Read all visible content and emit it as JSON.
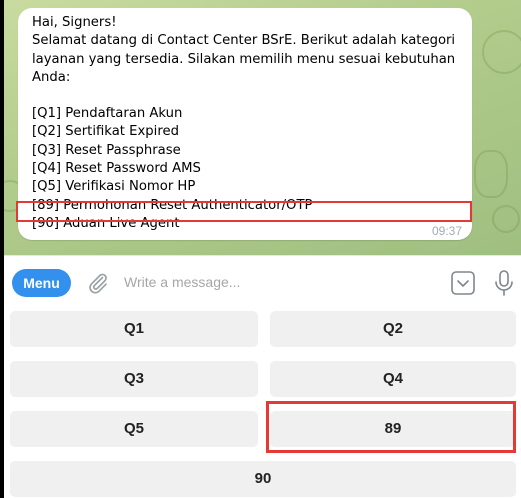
{
  "message": {
    "greeting": "Hai, Signers!",
    "intro": "Selamat datang di Contact Center BSrE. Berikut adalah kategori layanan yang tersedia. Silakan memilih menu sesuai kebutuhan Anda:",
    "items": [
      "[Q1] Pendaftaran Akun",
      "[Q2] Sertifikat Expired",
      "[Q3] Reset Passphrase",
      "[Q4] Reset Password AMS",
      "[Q5] Verifikasi Nomor HP",
      "[89] Permohonan Reset Authenticator/OTP",
      "[90] Aduan Live Agent"
    ],
    "time": "09:37"
  },
  "input_bar": {
    "menu_label": "Menu",
    "placeholder": "Write a message..."
  },
  "keyboard": {
    "buttons": [
      "Q1",
      "Q2",
      "Q3",
      "Q4",
      "Q5",
      "89",
      "90"
    ]
  },
  "colors": {
    "accent": "#3390ec",
    "highlight": "#e53935",
    "button_bg": "#f0f0f0",
    "chat_bg": "#b2cc8c"
  },
  "icons": {
    "attach": "paperclip-icon",
    "keyboard": "keyboard-toggle-icon",
    "mic": "microphone-icon"
  }
}
